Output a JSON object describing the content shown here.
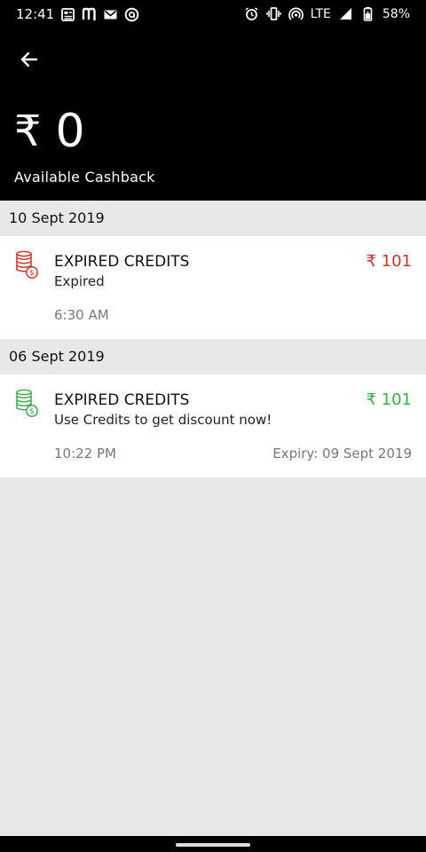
{
  "status_bar": {
    "time": "12:41",
    "network": "LTE",
    "battery": "58%",
    "icons_left": [
      "news-icon",
      "m-app-icon",
      "gmail-icon",
      "at-icon"
    ],
    "icons_right": [
      "alarm-icon",
      "vibrate-icon",
      "hotspot-icon",
      "signal-icon",
      "battery-icon"
    ]
  },
  "header": {
    "currency_symbol": "₹",
    "amount": "0",
    "label": "Available Cashback"
  },
  "groups": [
    {
      "date": "10 Sept 2019",
      "transactions": [
        {
          "title": "EXPIRED CREDITS",
          "subtitle": "Expired",
          "amount": "₹ 101",
          "time": "6:30 AM",
          "expiry": "",
          "color": "#c8332c",
          "icon": "coins-icon"
        }
      ]
    },
    {
      "date": "06 Sept 2019",
      "transactions": [
        {
          "title": "EXPIRED CREDITS",
          "subtitle": "Use Credits to get discount now!",
          "amount": "₹ 101",
          "time": "10:22 PM",
          "expiry": "Expiry: 09 Sept 2019",
          "color": "#3daa4b",
          "icon": "coins-icon"
        }
      ]
    }
  ]
}
